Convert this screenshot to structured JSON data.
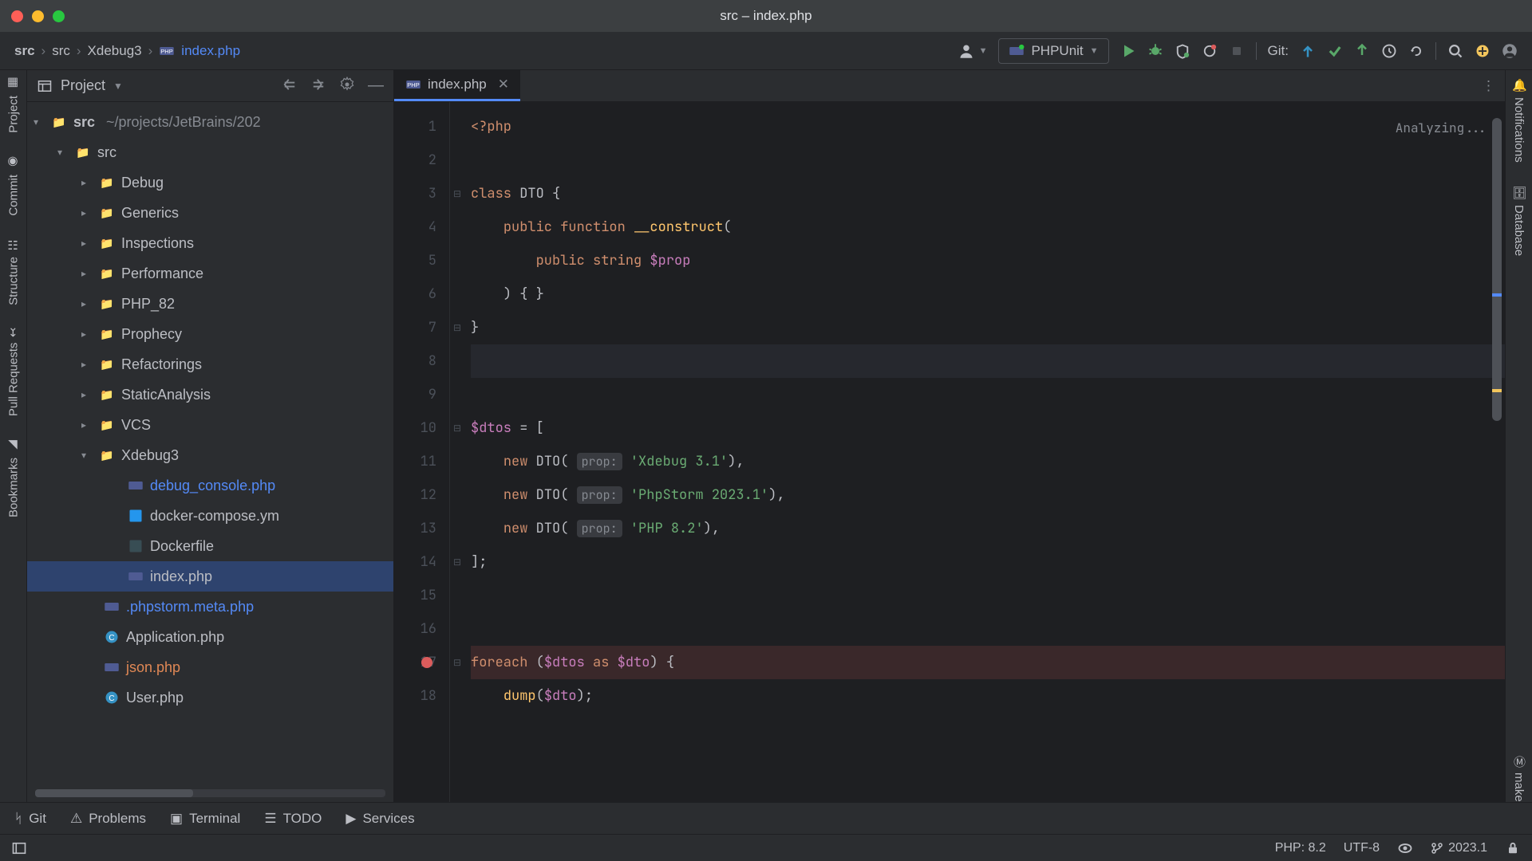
{
  "window": {
    "title": "src – index.php"
  },
  "breadcrumb": {
    "root": "src",
    "p1": "src",
    "p2": "Xdebug3",
    "file": "index.php"
  },
  "run_config": {
    "label": "PHPUnit"
  },
  "git_label": "Git:",
  "sidebar": {
    "title": "Project",
    "root": {
      "name": "src",
      "path": "~/projects/JetBrains/202"
    },
    "folders": [
      "Debug",
      "Generics",
      "Inspections",
      "Performance",
      "PHP_82",
      "Prophecy",
      "Refactorings",
      "StaticAnalysis",
      "VCS"
    ],
    "xdebug": {
      "name": "Xdebug3",
      "files": [
        "debug_console.php",
        "docker-compose.ym",
        "Dockerfile",
        "index.php"
      ]
    },
    "root_files": [
      ".phpstorm.meta.php",
      "Application.php",
      "json.php",
      "User.php"
    ]
  },
  "left_rail": [
    "Project",
    "Commit",
    "Structure",
    "Pull Requests",
    "Bookmarks"
  ],
  "right_rail": [
    "Notifications",
    "Database",
    "make"
  ],
  "tab": {
    "name": "index.php"
  },
  "analyzing": "Analyzing...",
  "code": {
    "l1": "php",
    "l3_class": "class",
    "l3_name": "DTO",
    "l4_pub": "public",
    "l4_fn": "function",
    "l4_name": "__construct",
    "l5_pub": "public",
    "l5_type": "string",
    "l5_var": "$prop",
    "l10_var": "$dtos",
    "hint": "prop:",
    "new": "new",
    "dtoclass": "DTO",
    "s1": "'Xdebug 3.1'",
    "s2": "'PhpStorm 2023.1'",
    "s3": "'PHP 8.2'",
    "foreach": "foreach",
    "as": "as",
    "l17_arr": "$dtos",
    "l17_it": "$dto",
    "dump": "dump",
    "l18_arg": "$dto"
  },
  "bottom": {
    "git": "Git",
    "problems": "Problems",
    "terminal": "Terminal",
    "todo": "TODO",
    "services": "Services"
  },
  "status": {
    "php": "PHP: 8.2",
    "enc": "UTF-8",
    "ver": "2023.1"
  }
}
